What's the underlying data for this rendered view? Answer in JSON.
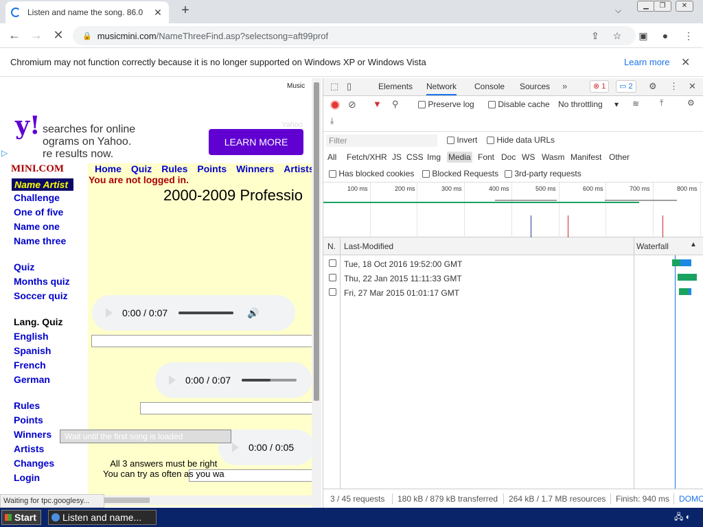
{
  "browser": {
    "tab_title": "Listen and name the song. 86.0",
    "new_tab": "+",
    "url_host": "musicmini.com",
    "url_path": "/NameThreeFind.asp?selectsong=aft99prof"
  },
  "infobar": {
    "message": "Chromium may not function correctly because it is no longer supported on Windows XP or Windows Vista",
    "learn_more": "Learn more"
  },
  "page": {
    "music_top": "Music",
    "ad": {
      "line1": "searches for online",
      "line2": "ograms on Yahoo.",
      "line3": "re results now.",
      "button": "LEARN MORE",
      "faint": "Yahoo"
    },
    "brand": "MINI.COM",
    "name_artist": "Name Artist",
    "nav_links": [
      "Challenge",
      "One of five",
      "Name one",
      "Name three",
      "Quiz",
      "Months quiz",
      "Soccer quiz",
      "Lang. Quiz",
      "English",
      "Spanish",
      "French",
      "German",
      "Rules",
      "Points",
      "Winners",
      "Artists",
      "Changes",
      "Login"
    ],
    "top_nav": [
      "Home",
      "Quiz",
      "Rules",
      "Points",
      "Winners",
      "Artists"
    ],
    "logged_out": "You are not logged in.",
    "heading": "2000-2009 Professio",
    "audio": [
      {
        "time": "0:00 / 0:07",
        "progress": 1.0
      },
      {
        "time": "0:00 / 0:07",
        "progress": 0.52
      },
      {
        "time": "0:00 / 0:05",
        "progress": 0.0
      }
    ],
    "submit_label": "Wait until the first song is loaded",
    "answers_line1": "All 3 answers must be right",
    "answers_line2": "You can try as often as you wa"
  },
  "status_bubble": "Waiting for tpc.googlesy...",
  "devtools": {
    "tabs": [
      "Elements",
      "Network",
      "Console",
      "Sources"
    ],
    "error_count": "1",
    "message_count": "2",
    "preserve_log": "Preserve log",
    "disable_cache": "Disable cache",
    "throttling": "No throttling",
    "filter_placeholder": "Filter",
    "invert": "Invert",
    "hide_data_urls": "Hide data URLs",
    "types": [
      "All",
      "Fetch/XHR",
      "JS",
      "CSS",
      "Img",
      "Media",
      "Font",
      "Doc",
      "WS",
      "Wasm",
      "Manifest",
      "Other"
    ],
    "has_blocked_cookies": "Has blocked cookies",
    "blocked_requests": "Blocked Requests",
    "third_party": "3rd-party requests",
    "ticks": [
      "100 ms",
      "200 ms",
      "300 ms",
      "400 ms",
      "500 ms",
      "600 ms",
      "700 ms",
      "800 ms"
    ],
    "col_n": "N.",
    "col_last_modified": "Last-Modified",
    "col_waterfall": "Waterfall",
    "rows": [
      {
        "last_modified": "Tue, 18 Oct 2016 19:52:00 GMT"
      },
      {
        "last_modified": "Thu, 22 Jan 2015 11:11:33 GMT"
      },
      {
        "last_modified": "Fri, 27 Mar 2015 01:01:17 GMT"
      }
    ],
    "status": {
      "requests": "3 / 45 requests",
      "transferred": "180 kB / 879 kB transferred",
      "resources": "264 kB / 1.7 MB resources",
      "finish": "Finish: 940 ms",
      "dom": "DOMC"
    }
  },
  "taskbar": {
    "start": "Start",
    "item": "Listen and name..."
  }
}
